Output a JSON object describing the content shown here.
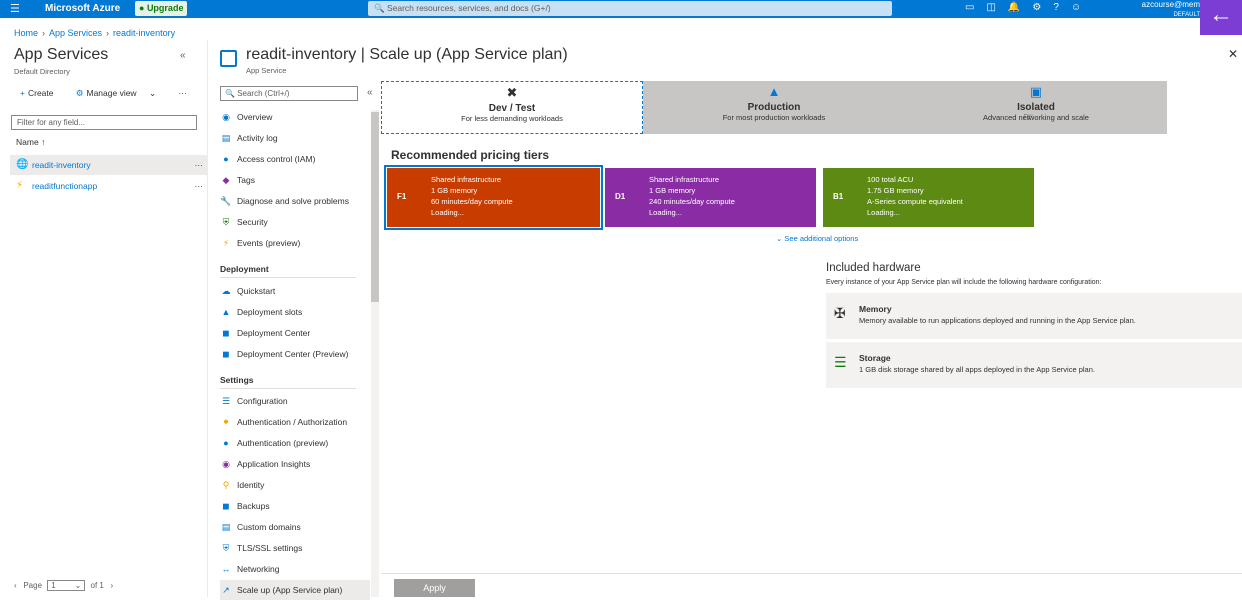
{
  "topbar": {
    "menu_icon": "hamburger-icon",
    "brand": "Microsoft Azure",
    "upgrade": "Upgrade",
    "search_placeholder": "Search resources, services, and docs (G+/)",
    "account": "azcourse@mem",
    "directory": "DEFAULT"
  },
  "breadcrumb": [
    "Home",
    "App Services",
    "readit-inventory"
  ],
  "left": {
    "title": "App Services",
    "subtitle": "Default Directory",
    "create": "Create",
    "manage_view": "Manage view",
    "filter_placeholder": "Filter for any field...",
    "col_name": "Name",
    "resources": [
      {
        "name": "readit-inventory",
        "selected": true,
        "icon": "app-service-icon"
      },
      {
        "name": "readitfunctionapp",
        "selected": false,
        "icon": "function-app-icon"
      }
    ],
    "pager": {
      "label": "Page",
      "value": "1",
      "of": "of 1"
    }
  },
  "page": {
    "title": "readit-inventory | Scale up (App Service plan)",
    "subtitle": "App Service"
  },
  "menu": {
    "search_placeholder": "Search (Ctrl+/)",
    "items": [
      {
        "label": "Overview"
      },
      {
        "label": "Activity log"
      },
      {
        "label": "Access control (IAM)"
      },
      {
        "label": "Tags"
      },
      {
        "label": "Diagnose and solve problems"
      },
      {
        "label": "Security"
      },
      {
        "label": "Events (preview)"
      }
    ],
    "deployment_header": "Deployment",
    "deployment": [
      {
        "label": "Quickstart"
      },
      {
        "label": "Deployment slots"
      },
      {
        "label": "Deployment Center"
      },
      {
        "label": "Deployment Center (Preview)"
      }
    ],
    "settings_header": "Settings",
    "settings": [
      {
        "label": "Configuration"
      },
      {
        "label": "Authentication / Authorization"
      },
      {
        "label": "Authentication (preview)"
      },
      {
        "label": "Application Insights"
      },
      {
        "label": "Identity"
      },
      {
        "label": "Backups"
      },
      {
        "label": "Custom domains"
      },
      {
        "label": "TLS/SSL settings"
      },
      {
        "label": "Networking"
      },
      {
        "label": "Scale up (App Service plan)"
      }
    ]
  },
  "tiers": [
    {
      "name": "Dev / Test",
      "desc": "For less demanding workloads",
      "selected": true
    },
    {
      "name": "Production",
      "desc": "For most production workloads",
      "selected": false
    },
    {
      "name": "Isolated",
      "desc": "Advanced networking and scale",
      "selected": false
    }
  ],
  "recommended_title": "Recommended pricing tiers",
  "cards": [
    {
      "code": "F1",
      "color": "#c83c00",
      "lines": [
        "Shared infrastructure",
        "1 GB memory",
        "60 minutes/day compute",
        "Loading..."
      ],
      "selected": true
    },
    {
      "code": "D1",
      "color": "#8a2da5",
      "lines": [
        "Shared infrastructure",
        "1 GB memory",
        "240 minutes/day compute",
        "Loading..."
      ],
      "selected": false
    },
    {
      "code": "B1",
      "color": "#5d8a12",
      "lines": [
        "100 total ACU",
        "1.75 GB memory",
        "A-Series compute equivalent",
        "Loading..."
      ],
      "selected": false
    }
  ],
  "see_more": "See additional options",
  "hardware": {
    "title": "Included hardware",
    "desc": "Every instance of your App Service plan will include the following hardware configuration:",
    "items": [
      {
        "name": "Memory",
        "text": "Memory available to run applications deployed and running in the App Service plan."
      },
      {
        "name": "Storage",
        "text": "1 GB disk storage shared by all apps deployed in the App Service plan."
      }
    ]
  },
  "apply": "Apply"
}
